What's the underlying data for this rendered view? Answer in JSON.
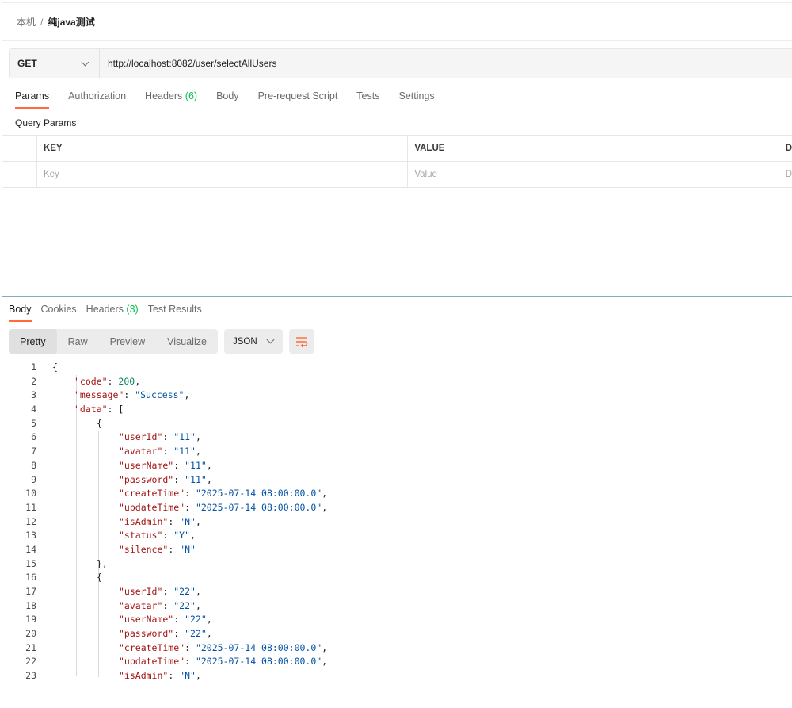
{
  "breadcrumb": {
    "root": "本机",
    "separator": "/",
    "current": "纯java测试"
  },
  "request": {
    "method": "GET",
    "url": "http://localhost:8082/user/selectAllUsers"
  },
  "request_tabs": [
    {
      "label": "Params",
      "active": true
    },
    {
      "label": "Authorization"
    },
    {
      "label": "Headers",
      "count": "(6)"
    },
    {
      "label": "Body"
    },
    {
      "label": "Pre-request Script"
    },
    {
      "label": "Tests"
    },
    {
      "label": "Settings"
    }
  ],
  "query_params": {
    "title": "Query Params",
    "columns": {
      "key": "KEY",
      "value": "VALUE",
      "desc": "D"
    },
    "placeholders": {
      "key": "Key",
      "value": "Value",
      "desc": "D"
    }
  },
  "response_tabs": [
    {
      "label": "Body",
      "active": true
    },
    {
      "label": "Cookies"
    },
    {
      "label": "Headers",
      "count": "(3)"
    },
    {
      "label": "Test Results"
    }
  ],
  "view_modes": [
    "Pretty",
    "Raw",
    "Preview",
    "Visualize"
  ],
  "active_view": "Pretty",
  "format": "JSON",
  "icons": {
    "method_dropdown": "chevron-down-icon",
    "format_dropdown": "chevron-down-icon",
    "wrap": "wrap-lines-icon"
  },
  "colors": {
    "accent": "#ff6c37",
    "count": "#0cbb52",
    "json_key": "#a31515",
    "json_string": "#0451a5",
    "json_number": "#098658"
  },
  "code_lines": [
    {
      "n": "1",
      "indent": 0,
      "tokens": [
        [
          "p",
          "{"
        ]
      ]
    },
    {
      "n": "2",
      "indent": 1,
      "tokens": [
        [
          "k",
          "\"code\""
        ],
        [
          "p",
          ": "
        ],
        [
          "n",
          "200"
        ],
        [
          "p",
          ","
        ]
      ]
    },
    {
      "n": "3",
      "indent": 1,
      "tokens": [
        [
          "k",
          "\"message\""
        ],
        [
          "p",
          ": "
        ],
        [
          "s",
          "\"Success\""
        ],
        [
          "p",
          ","
        ]
      ]
    },
    {
      "n": "4",
      "indent": 1,
      "tokens": [
        [
          "k",
          "\"data\""
        ],
        [
          "p",
          ": ["
        ]
      ]
    },
    {
      "n": "5",
      "indent": 2,
      "tokens": [
        [
          "p",
          "{"
        ]
      ]
    },
    {
      "n": "6",
      "indent": 3,
      "tokens": [
        [
          "k",
          "\"userId\""
        ],
        [
          "p",
          ": "
        ],
        [
          "s",
          "\"11\""
        ],
        [
          "p",
          ","
        ]
      ]
    },
    {
      "n": "7",
      "indent": 3,
      "tokens": [
        [
          "k",
          "\"avatar\""
        ],
        [
          "p",
          ": "
        ],
        [
          "s",
          "\"11\""
        ],
        [
          "p",
          ","
        ]
      ]
    },
    {
      "n": "8",
      "indent": 3,
      "tokens": [
        [
          "k",
          "\"userName\""
        ],
        [
          "p",
          ": "
        ],
        [
          "s",
          "\"11\""
        ],
        [
          "p",
          ","
        ]
      ]
    },
    {
      "n": "9",
      "indent": 3,
      "tokens": [
        [
          "k",
          "\"password\""
        ],
        [
          "p",
          ": "
        ],
        [
          "s",
          "\"11\""
        ],
        [
          "p",
          ","
        ]
      ]
    },
    {
      "n": "10",
      "indent": 3,
      "tokens": [
        [
          "k",
          "\"createTime\""
        ],
        [
          "p",
          ": "
        ],
        [
          "s",
          "\"2025-07-14 08:00:00.0\""
        ],
        [
          "p",
          ","
        ]
      ]
    },
    {
      "n": "11",
      "indent": 3,
      "tokens": [
        [
          "k",
          "\"updateTime\""
        ],
        [
          "p",
          ": "
        ],
        [
          "s",
          "\"2025-07-14 08:00:00.0\""
        ],
        [
          "p",
          ","
        ]
      ]
    },
    {
      "n": "12",
      "indent": 3,
      "tokens": [
        [
          "k",
          "\"isAdmin\""
        ],
        [
          "p",
          ": "
        ],
        [
          "s",
          "\"N\""
        ],
        [
          "p",
          ","
        ]
      ]
    },
    {
      "n": "13",
      "indent": 3,
      "tokens": [
        [
          "k",
          "\"status\""
        ],
        [
          "p",
          ": "
        ],
        [
          "s",
          "\"Y\""
        ],
        [
          "p",
          ","
        ]
      ]
    },
    {
      "n": "14",
      "indent": 3,
      "tokens": [
        [
          "k",
          "\"silence\""
        ],
        [
          "p",
          ": "
        ],
        [
          "s",
          "\"N\""
        ]
      ]
    },
    {
      "n": "15",
      "indent": 2,
      "tokens": [
        [
          "p",
          "},"
        ]
      ]
    },
    {
      "n": "16",
      "indent": 2,
      "tokens": [
        [
          "p",
          "{"
        ]
      ]
    },
    {
      "n": "17",
      "indent": 3,
      "tokens": [
        [
          "k",
          "\"userId\""
        ],
        [
          "p",
          ": "
        ],
        [
          "s",
          "\"22\""
        ],
        [
          "p",
          ","
        ]
      ]
    },
    {
      "n": "18",
      "indent": 3,
      "tokens": [
        [
          "k",
          "\"avatar\""
        ],
        [
          "p",
          ": "
        ],
        [
          "s",
          "\"22\""
        ],
        [
          "p",
          ","
        ]
      ]
    },
    {
      "n": "19",
      "indent": 3,
      "tokens": [
        [
          "k",
          "\"userName\""
        ],
        [
          "p",
          ": "
        ],
        [
          "s",
          "\"22\""
        ],
        [
          "p",
          ","
        ]
      ]
    },
    {
      "n": "20",
      "indent": 3,
      "tokens": [
        [
          "k",
          "\"password\""
        ],
        [
          "p",
          ": "
        ],
        [
          "s",
          "\"22\""
        ],
        [
          "p",
          ","
        ]
      ]
    },
    {
      "n": "21",
      "indent": 3,
      "tokens": [
        [
          "k",
          "\"createTime\""
        ],
        [
          "p",
          ": "
        ],
        [
          "s",
          "\"2025-07-14 08:00:00.0\""
        ],
        [
          "p",
          ","
        ]
      ]
    },
    {
      "n": "22",
      "indent": 3,
      "tokens": [
        [
          "k",
          "\"updateTime\""
        ],
        [
          "p",
          ": "
        ],
        [
          "s",
          "\"2025-07-14 08:00:00.0\""
        ],
        [
          "p",
          ","
        ]
      ]
    },
    {
      "n": "23",
      "indent": 3,
      "tokens": [
        [
          "k",
          "\"isAdmin\""
        ],
        [
          "p",
          ": "
        ],
        [
          "s",
          "\"N\""
        ],
        [
          "p",
          ","
        ]
      ]
    }
  ]
}
